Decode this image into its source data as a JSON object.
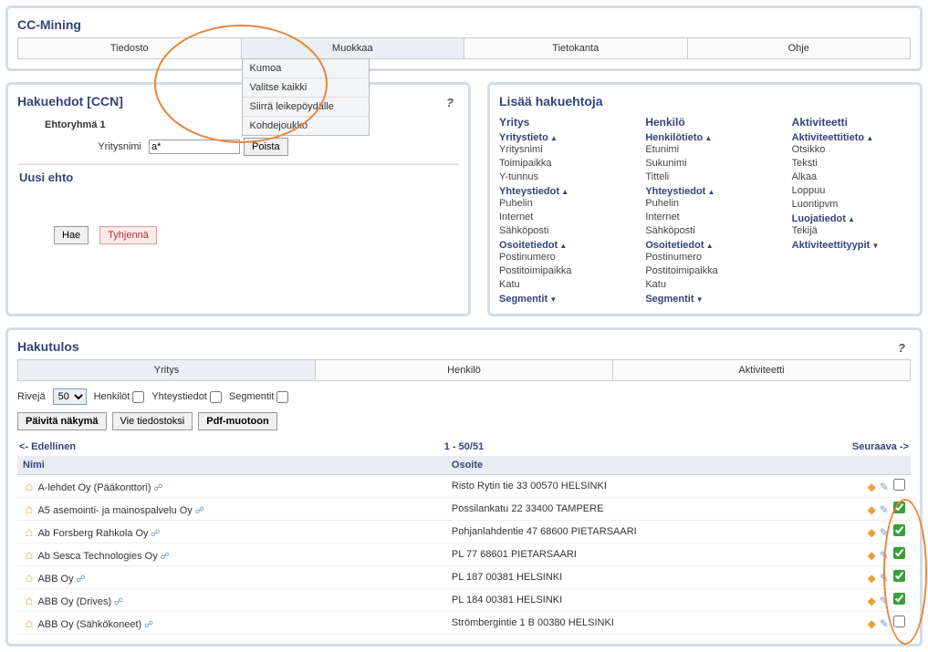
{
  "app": {
    "title": "CC-Mining"
  },
  "menu": {
    "items": [
      "Tiedosto",
      "Muokkaa",
      "Tietokanta",
      "Ohje"
    ],
    "dropdown": [
      "Kumoa",
      "Valitse kaikki",
      "Siirrä leikepöydälle",
      "Kohdejoukko"
    ]
  },
  "hakuehdot": {
    "title": "Hakuehdot [CCN]",
    "group": "Ehtoryhmä 1",
    "field_label": "Yritysnimi",
    "field_value": "a*",
    "poista": "Poista",
    "uusi": "Uusi ehto",
    "hae": "Hae",
    "tyhjenna": "Tyhjennä"
  },
  "lisaa": {
    "title": "Lisää hakuehtoja",
    "cols": [
      {
        "head": "Yritys",
        "groups": [
          {
            "label": "Yritystieto",
            "up": true,
            "subs": [
              "Yritysnimi",
              "Toimipaikka",
              "Y-tunnus"
            ]
          },
          {
            "label": "Yhteystiedot",
            "up": true,
            "subs": [
              "Puhelin",
              "Internet",
              "Sähköposti"
            ]
          },
          {
            "label": "Osoitetiedot",
            "up": true,
            "subs": [
              "Postinumero",
              "Postitoimipaikka",
              "Katu"
            ]
          },
          {
            "label": "Segmentit",
            "down": true,
            "subs": []
          }
        ]
      },
      {
        "head": "Henkilö",
        "groups": [
          {
            "label": "Henkilötieto",
            "up": true,
            "subs": [
              "Etunimi",
              "Sukunimi",
              "Titteli"
            ]
          },
          {
            "label": "Yhteystiedot",
            "up": true,
            "subs": [
              "Puhelin",
              "Internet",
              "Sähköposti"
            ]
          },
          {
            "label": "Osoitetiedot",
            "up": true,
            "subs": [
              "Postinumero",
              "Postitoimipaikka",
              "Katu"
            ]
          },
          {
            "label": "Segmentit",
            "down": true,
            "subs": []
          }
        ]
      },
      {
        "head": "Aktiviteetti",
        "groups": [
          {
            "label": "Aktiviteettitieto",
            "up": true,
            "subs": [
              "Otsikko",
              "Teksti",
              "Alkaa",
              "Loppuu",
              "Luontipvm"
            ]
          },
          {
            "label": "Luojatiedot",
            "up": true,
            "subs": [
              "Tekijä"
            ]
          },
          {
            "label": "Aktiviteettityypit",
            "down": true,
            "subs": []
          }
        ]
      }
    ]
  },
  "hakutulos": {
    "title": "Hakutulos",
    "tabs": [
      "Yritys",
      "Henkilö",
      "Aktiviteetti"
    ],
    "riveja_label": "Rivejä",
    "riveja_value": "50",
    "filters": [
      "Henkilöt",
      "Yhteystiedot",
      "Segmentit"
    ],
    "buttons": {
      "paivita": "Päivitä näkymä",
      "vie": "Vie tiedostoksi",
      "pdf": "Pdf-muotoon"
    },
    "pager": {
      "prev": "<- Edellinen",
      "range": "1 - 50/51",
      "next": "Seuraava ->"
    },
    "cols": [
      "Nimi",
      "Osoite"
    ],
    "rows": [
      {
        "name": "A-lehdet Oy (Pääkonttori)",
        "addr": "Risto Rytin tie 33 00570 HELSINKI",
        "checked": false
      },
      {
        "name": "A5 asemointi- ja mainospalvelu Oy",
        "addr": "Possilankatu 22 33400 TAMPERE",
        "checked": true
      },
      {
        "name": "Ab Forsberg Rahkola Oy",
        "addr": "Pohjanlahdentie 47 68600 PIETARSAARI",
        "checked": true
      },
      {
        "name": "Ab Sesca Technologies Oy",
        "addr": "PL 77 68601 PIETARSAARI",
        "checked": true
      },
      {
        "name": "ABB Oy",
        "addr": "PL 187 00381 HELSINKI",
        "checked": true
      },
      {
        "name": "ABB Oy (Drives)",
        "addr": "PL 184 00381 HELSINKI",
        "checked": true
      },
      {
        "name": "ABB Oy (Sähkökoneet)",
        "addr": "Strömbergintie 1 B 00380 HELSINKI",
        "checked": false
      }
    ]
  }
}
